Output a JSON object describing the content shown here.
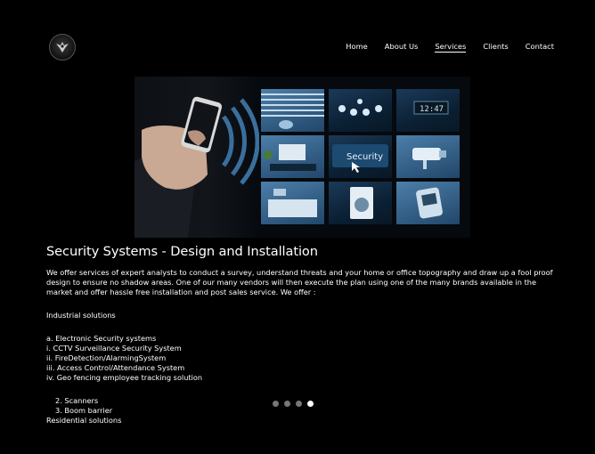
{
  "header": {
    "nav": [
      "Home",
      "About Us",
      "Services",
      "Clients",
      "Contact"
    ],
    "active": "Services"
  },
  "hero": {
    "security_label": "Security",
    "clock": "12:47"
  },
  "main": {
    "title": "Security Systems - Design and Installation",
    "intro": "We offer services of expert analysts to conduct a survey, understand threats and your home or office topography and draw up a fool proof design to ensure no shadow areas. One of our many vendors will then execute the plan using one of the many brands available in the market and offer hassle free installation and post sales service. We offer :",
    "industrial_heading": "Industrial solutions",
    "list": [
      "a. Electronic Security systems",
      "i. CCTV Surveillance Security System",
      "ii. FireDetection/AlarmingSystem",
      "iii. Access Control/Attendance System",
      "iv. Geo fencing employee tracking solution"
    ],
    "sub_list": [
      "2. Scanners",
      "3. Boom barrier"
    ],
    "residential_heading": "Residential solutions"
  },
  "slider": {
    "count": 4,
    "active_index": 3
  }
}
